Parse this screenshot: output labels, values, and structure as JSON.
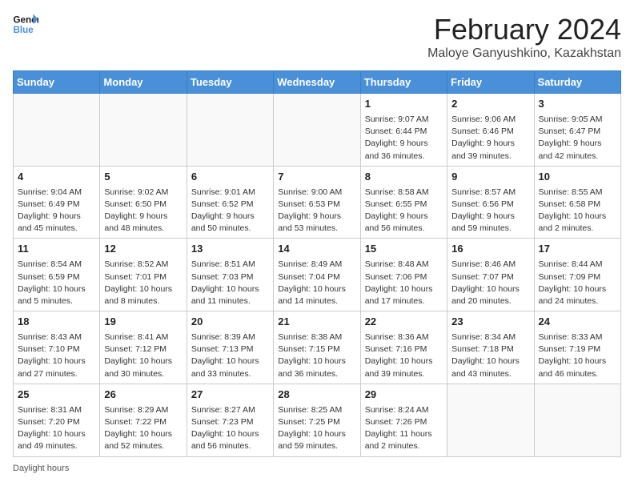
{
  "logo": {
    "line1": "General",
    "line2": "Blue"
  },
  "title": "February 2024",
  "subtitle": "Maloye Ganyushkino, Kazakhstan",
  "weekdays": [
    "Sunday",
    "Monday",
    "Tuesday",
    "Wednesday",
    "Thursday",
    "Friday",
    "Saturday"
  ],
  "weeks": [
    [
      {
        "day": "",
        "detail": ""
      },
      {
        "day": "",
        "detail": ""
      },
      {
        "day": "",
        "detail": ""
      },
      {
        "day": "",
        "detail": ""
      },
      {
        "day": "1",
        "detail": "Sunrise: 9:07 AM\nSunset: 6:44 PM\nDaylight: 9 hours and 36 minutes."
      },
      {
        "day": "2",
        "detail": "Sunrise: 9:06 AM\nSunset: 6:46 PM\nDaylight: 9 hours and 39 minutes."
      },
      {
        "day": "3",
        "detail": "Sunrise: 9:05 AM\nSunset: 6:47 PM\nDaylight: 9 hours and 42 minutes."
      }
    ],
    [
      {
        "day": "4",
        "detail": "Sunrise: 9:04 AM\nSunset: 6:49 PM\nDaylight: 9 hours and 45 minutes."
      },
      {
        "day": "5",
        "detail": "Sunrise: 9:02 AM\nSunset: 6:50 PM\nDaylight: 9 hours and 48 minutes."
      },
      {
        "day": "6",
        "detail": "Sunrise: 9:01 AM\nSunset: 6:52 PM\nDaylight: 9 hours and 50 minutes."
      },
      {
        "day": "7",
        "detail": "Sunrise: 9:00 AM\nSunset: 6:53 PM\nDaylight: 9 hours and 53 minutes."
      },
      {
        "day": "8",
        "detail": "Sunrise: 8:58 AM\nSunset: 6:55 PM\nDaylight: 9 hours and 56 minutes."
      },
      {
        "day": "9",
        "detail": "Sunrise: 8:57 AM\nSunset: 6:56 PM\nDaylight: 9 hours and 59 minutes."
      },
      {
        "day": "10",
        "detail": "Sunrise: 8:55 AM\nSunset: 6:58 PM\nDaylight: 10 hours and 2 minutes."
      }
    ],
    [
      {
        "day": "11",
        "detail": "Sunrise: 8:54 AM\nSunset: 6:59 PM\nDaylight: 10 hours and 5 minutes."
      },
      {
        "day": "12",
        "detail": "Sunrise: 8:52 AM\nSunset: 7:01 PM\nDaylight: 10 hours and 8 minutes."
      },
      {
        "day": "13",
        "detail": "Sunrise: 8:51 AM\nSunset: 7:03 PM\nDaylight: 10 hours and 11 minutes."
      },
      {
        "day": "14",
        "detail": "Sunrise: 8:49 AM\nSunset: 7:04 PM\nDaylight: 10 hours and 14 minutes."
      },
      {
        "day": "15",
        "detail": "Sunrise: 8:48 AM\nSunset: 7:06 PM\nDaylight: 10 hours and 17 minutes."
      },
      {
        "day": "16",
        "detail": "Sunrise: 8:46 AM\nSunset: 7:07 PM\nDaylight: 10 hours and 20 minutes."
      },
      {
        "day": "17",
        "detail": "Sunrise: 8:44 AM\nSunset: 7:09 PM\nDaylight: 10 hours and 24 minutes."
      }
    ],
    [
      {
        "day": "18",
        "detail": "Sunrise: 8:43 AM\nSunset: 7:10 PM\nDaylight: 10 hours and 27 minutes."
      },
      {
        "day": "19",
        "detail": "Sunrise: 8:41 AM\nSunset: 7:12 PM\nDaylight: 10 hours and 30 minutes."
      },
      {
        "day": "20",
        "detail": "Sunrise: 8:39 AM\nSunset: 7:13 PM\nDaylight: 10 hours and 33 minutes."
      },
      {
        "day": "21",
        "detail": "Sunrise: 8:38 AM\nSunset: 7:15 PM\nDaylight: 10 hours and 36 minutes."
      },
      {
        "day": "22",
        "detail": "Sunrise: 8:36 AM\nSunset: 7:16 PM\nDaylight: 10 hours and 39 minutes."
      },
      {
        "day": "23",
        "detail": "Sunrise: 8:34 AM\nSunset: 7:18 PM\nDaylight: 10 hours and 43 minutes."
      },
      {
        "day": "24",
        "detail": "Sunrise: 8:33 AM\nSunset: 7:19 PM\nDaylight: 10 hours and 46 minutes."
      }
    ],
    [
      {
        "day": "25",
        "detail": "Sunrise: 8:31 AM\nSunset: 7:20 PM\nDaylight: 10 hours and 49 minutes."
      },
      {
        "day": "26",
        "detail": "Sunrise: 8:29 AM\nSunset: 7:22 PM\nDaylight: 10 hours and 52 minutes."
      },
      {
        "day": "27",
        "detail": "Sunrise: 8:27 AM\nSunset: 7:23 PM\nDaylight: 10 hours and 56 minutes."
      },
      {
        "day": "28",
        "detail": "Sunrise: 8:25 AM\nSunset: 7:25 PM\nDaylight: 10 hours and 59 minutes."
      },
      {
        "day": "29",
        "detail": "Sunrise: 8:24 AM\nSunset: 7:26 PM\nDaylight: 11 hours and 2 minutes."
      },
      {
        "day": "",
        "detail": ""
      },
      {
        "day": "",
        "detail": ""
      }
    ]
  ],
  "footer": "Daylight hours"
}
